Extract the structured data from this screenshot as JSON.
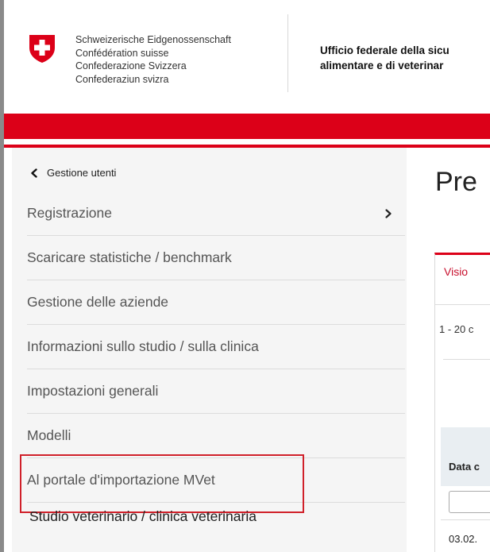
{
  "header": {
    "federation_lines": [
      "Schweizerische Eidgenossenschaft",
      "Confédération suisse",
      "Confederazione Svizzera",
      "Confederaziun svizra"
    ],
    "office_line1": "Ufficio federale della sicu",
    "office_line2": "alimentare e di veterinar"
  },
  "sidebar": {
    "back_label": "Gestione utenti",
    "items": [
      {
        "label": "Registrazione"
      },
      {
        "label": "Scaricare statistiche / benchmark"
      },
      {
        "label": "Gestione delle aziende"
      },
      {
        "label": "Informazioni sullo studio / sulla clinica"
      },
      {
        "label": "Impostazioni generali"
      },
      {
        "label": "Modelli"
      },
      {
        "label": "Al portale d'importazione MVet"
      }
    ],
    "sub_item": "Studio veterinario / clinica veterinaria"
  },
  "main": {
    "title": "Pre",
    "tab_label": "Visio",
    "count_text": "1 - 20 c",
    "table_header": "Data c",
    "first_cell": "03.02."
  },
  "colors": {
    "accent_red": "#dc0018",
    "highlight_border": "#d0202a"
  }
}
